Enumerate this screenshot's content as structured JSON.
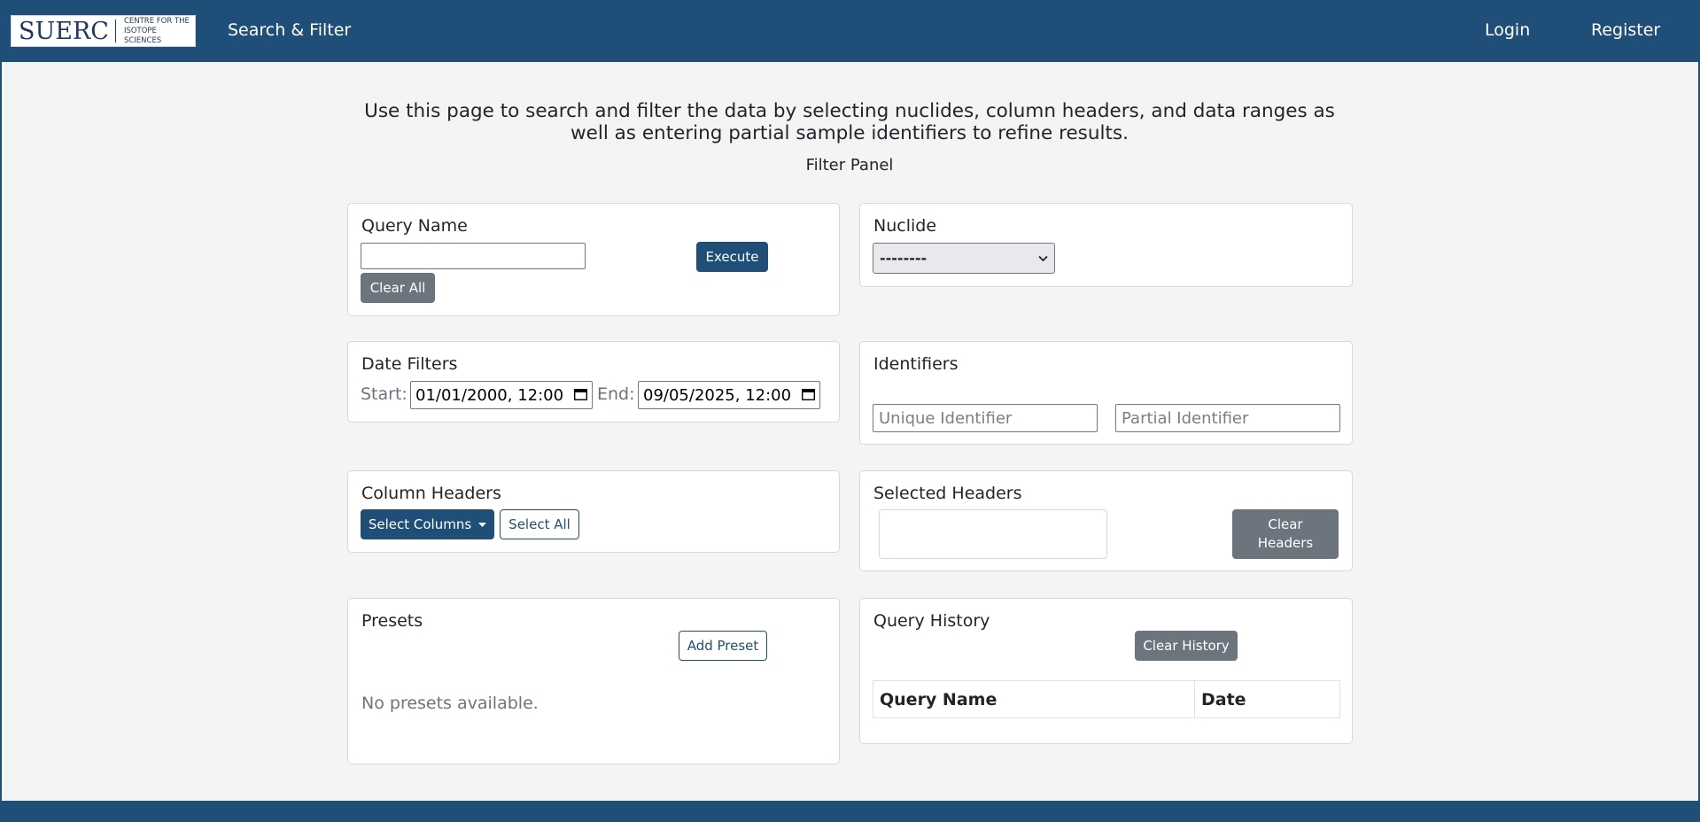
{
  "nav": {
    "logo_text": "SUERC",
    "logo_sub_line1": "CENTRE FOR THE",
    "logo_sub_line2": "ISOTOPE SCIENCES",
    "search_filter": "Search & Filter",
    "login": "Login",
    "register": "Register"
  },
  "intro": {
    "description": "Use this page to search and filter the data by selecting nuclides, column headers, and data ranges as well as entering partial sample identifiers to refine results.",
    "panel_title": "Filter Panel"
  },
  "query": {
    "title": "Query Name",
    "input_value": "",
    "execute_label": "Execute",
    "clear_all_label": "Clear All"
  },
  "nuclide": {
    "title": "Nuclide",
    "selected": "--------"
  },
  "dates": {
    "title": "Date Filters",
    "start_label": "Start:",
    "start_value": "01/01/2000, 12:00",
    "end_label": "End:",
    "end_value": "09/05/2025, 12:00"
  },
  "identifiers": {
    "title": "Identifiers",
    "unique_placeholder": "Unique Identifier",
    "partial_placeholder": "Partial Identifier"
  },
  "columns": {
    "title": "Column Headers",
    "select_columns_label": "Select Columns",
    "select_all_label": "Select All"
  },
  "selected_headers": {
    "title": "Selected Headers",
    "clear_headers_label": "Clear Headers"
  },
  "presets": {
    "title": "Presets",
    "add_preset_label": "Add Preset",
    "empty_text": "No presets available."
  },
  "history": {
    "title": "Query History",
    "clear_history_label": "Clear History",
    "columns": [
      "Query Name",
      "Date"
    ]
  },
  "colors": {
    "brand": "#1f4e79",
    "secondary": "#6c757d",
    "background": "#f4f4f4"
  }
}
